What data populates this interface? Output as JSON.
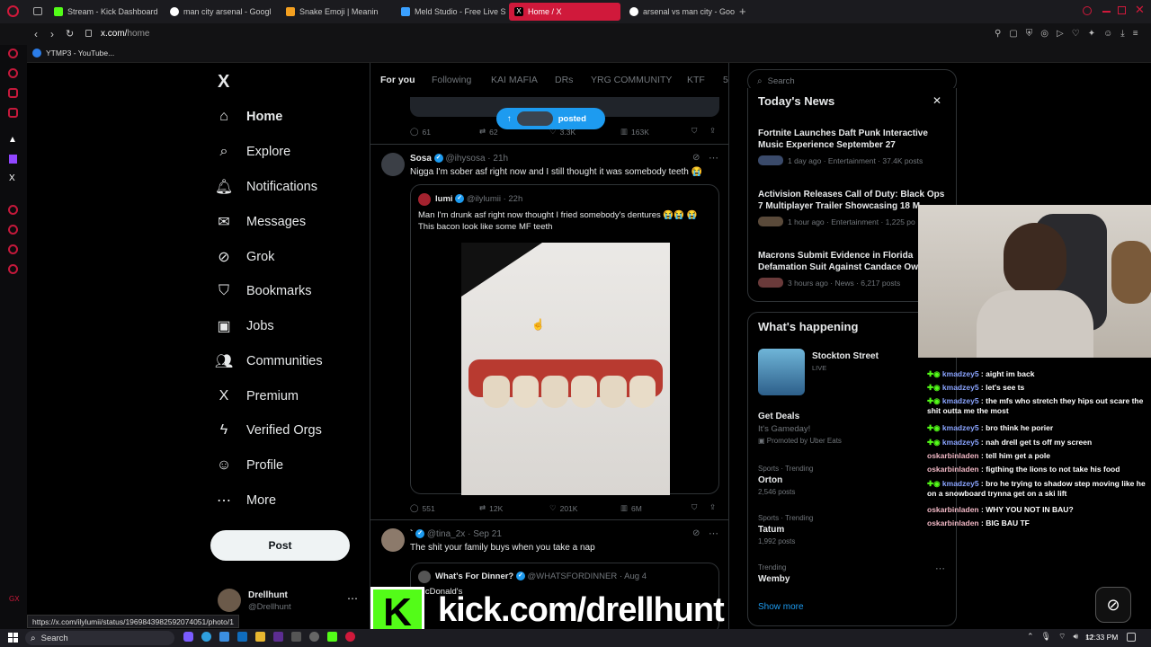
{
  "browser": {
    "tabs": [
      {
        "label": "Stream - Kick Dashboard",
        "color": "#53fc18"
      },
      {
        "label": "man city arsenal - Googl",
        "color": "#ffffff"
      },
      {
        "label": "Snake Emoji | Meanin",
        "color": "#f4a020"
      },
      {
        "label": "Meld Studio - Free Live S",
        "color": "#3aa0ff"
      },
      {
        "label": "Home / X",
        "color": "#000000"
      },
      {
        "label": "arsenal vs man city - Goo",
        "color": "#ffffff"
      }
    ],
    "url_prefix": "x.com/",
    "url_path": "home",
    "bookmark": "YTMP3 - YouTube...",
    "status_url": "https://x.com/ilylumii/status/1969843982592074051/photo/1"
  },
  "nav": {
    "logo": "X",
    "items": [
      {
        "label": "Home",
        "icon": "home-icon",
        "glyph": "⌂"
      },
      {
        "label": "Explore",
        "icon": "search-icon",
        "glyph": "⌕"
      },
      {
        "label": "Notifications",
        "icon": "bell-icon",
        "glyph": "🔔︎"
      },
      {
        "label": "Messages",
        "icon": "mail-icon",
        "glyph": "✉"
      },
      {
        "label": "Grok",
        "icon": "grok-icon",
        "glyph": "⊘"
      },
      {
        "label": "Bookmarks",
        "icon": "bookmark-icon",
        "glyph": "⛉"
      },
      {
        "label": "Jobs",
        "icon": "briefcase-icon",
        "glyph": "▣"
      },
      {
        "label": "Communities",
        "icon": "people-icon",
        "glyph": "👥︎"
      },
      {
        "label": "Premium",
        "icon": "x-logo-icon",
        "glyph": "X"
      },
      {
        "label": "Verified Orgs",
        "icon": "lightning-icon",
        "glyph": "ϟ"
      },
      {
        "label": "Profile",
        "icon": "person-icon",
        "glyph": "☺"
      },
      {
        "label": "More",
        "icon": "more-circle-icon",
        "glyph": "⋯"
      }
    ],
    "post_label": "Post",
    "account_name": "Drellhunt",
    "account_handle": "@Drellhunt"
  },
  "timeline": {
    "tabs": [
      "For you",
      "Following",
      "KAI MAFIA",
      "DRs",
      "YRG COMMUNITY",
      "KTF",
      "5"
    ],
    "posted_pill": "posted",
    "tweet0_metrics": {
      "replies": "61",
      "retweets": "62",
      "likes": "3.3K",
      "views": "163K"
    },
    "tweet1": {
      "name": "Sosa",
      "handle": "@ihysosa · 21h",
      "text": "Nigga I'm sober asf right now and I still thought it was somebody teeth 😭",
      "quote_name": "lumi",
      "quote_handle": "@ilylumii · 22h",
      "quote_text": "Man I'm drunk asf right now thought I fried somebody's dentures 😭😭 😭 This bacon look like some MF teeth",
      "replies": "551",
      "retweets": "12K",
      "likes": "201K",
      "views": "6M"
    },
    "tweet2": {
      "name": "`",
      "handle": "@tina_2x · Sep 21",
      "text": "The shit your family buys when you take a nap",
      "quote_name": "What's For Dinner?",
      "quote_handle": "@WHATSFORDINNER · Aug 4",
      "quote_text": "McDonald's"
    }
  },
  "sidebar": {
    "search_placeholder": "Search",
    "news_title": "Today's News",
    "news": [
      {
        "title": "Fortnite Launches Daft Punk Interactive Music Experience September 27",
        "meta": "1 day ago · Entertainment · 37.4K posts"
      },
      {
        "title": "Activision Releases Call of Duty: Black Ops 7 Multiplayer Trailer Showcasing 18 M",
        "meta": "1 hour ago · Entertainment · 1,225 po"
      },
      {
        "title": "Macrons Submit Evidence in Florida Defamation Suit Against Candace Ow",
        "meta": "3 hours ago · News · 6,217 posts"
      }
    ],
    "happening_title": "What's happening",
    "live_title": "Stockton Street",
    "live_badge": "LIVE",
    "promo_title": "Get Deals",
    "promo_sub": "It's Gameday!",
    "promo_by": "Promoted by Uber Eats",
    "trends": [
      {
        "category": "Sports · Trending",
        "name": "Orton",
        "count": "2,546 posts"
      },
      {
        "category": "Sports · Trending",
        "name": "Tatum",
        "count": "1,992 posts"
      },
      {
        "category": "Trending",
        "name": "Wemby",
        "count": ""
      }
    ],
    "show_more": "Show more"
  },
  "chat": [
    {
      "user": "kmadzey5",
      "msg": "aight im back",
      "badge": true
    },
    {
      "user": "kmadzey5",
      "msg": "let's see ts",
      "badge": true
    },
    {
      "user": "kmadzey5",
      "msg": "the mfs who stretch they hips out scare the shit outta me the most",
      "badge": true
    },
    {
      "user": "kmadzey5",
      "msg": "bro think he porier",
      "badge": true
    },
    {
      "user": "kmadzey5",
      "msg": "nah drell get ts off my screen",
      "badge": true
    },
    {
      "user": "oskarbinladen",
      "msg": "tell him get a pole",
      "badge": false
    },
    {
      "user": "oskarbinladen",
      "msg": "figthing the lions to not take his food",
      "badge": false
    },
    {
      "user": "kmadzey5",
      "msg": "bro he trying to shadow step moving like he on a snowboard trynna get on a ski lift",
      "badge": true
    },
    {
      "user": "oskarbinladen",
      "msg": "WHY YOU NOT IN BAU?",
      "badge": false
    },
    {
      "user": "oskarbinladen",
      "msg": "BIG BAU TF",
      "badge": false
    }
  ],
  "overlay": {
    "kick_text": "kick.com/drellhunt",
    "kick_logo": "K",
    "kick_color": "#53fc18"
  },
  "taskbar": {
    "search": "Search",
    "time": "12:33 PM"
  }
}
